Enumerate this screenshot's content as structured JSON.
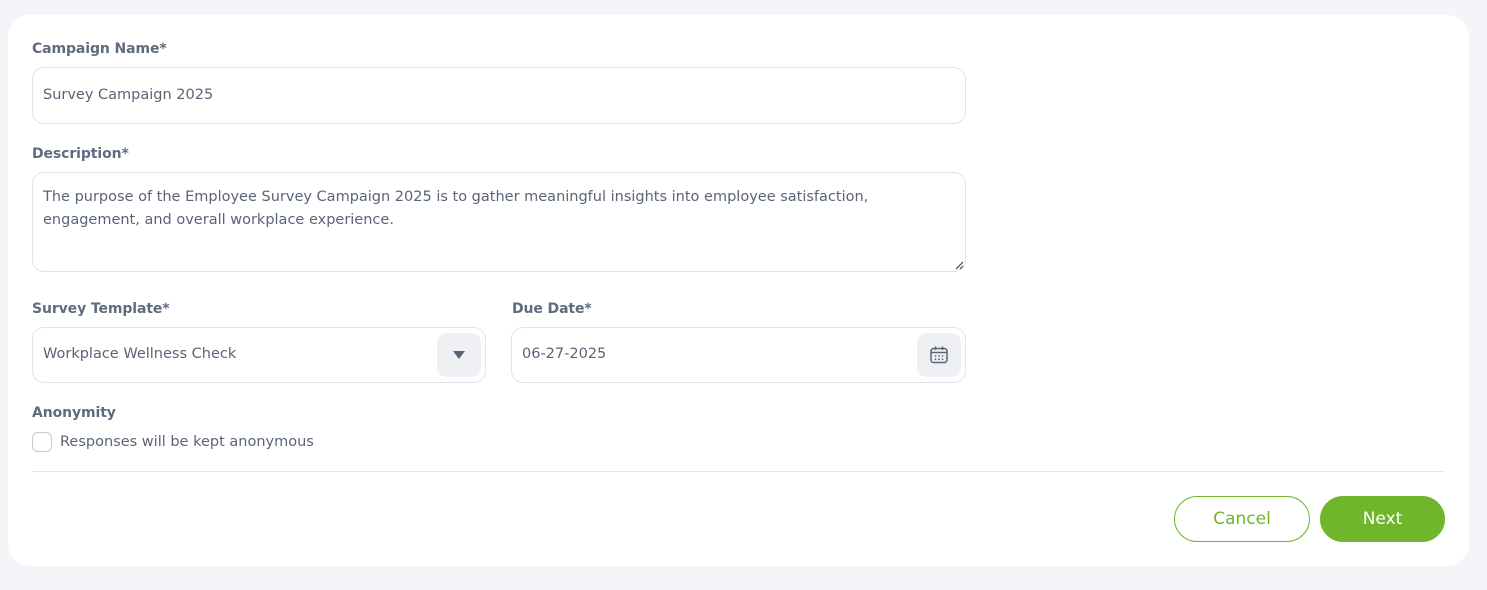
{
  "form": {
    "campaign_name": {
      "label": "Campaign Name*",
      "value": "Survey Campaign 2025"
    },
    "description": {
      "label": "Description*",
      "value": "The purpose of the Employee Survey Campaign 2025 is to gather meaningful insights into employee satisfaction, engagement, and overall workplace experience."
    },
    "survey_template": {
      "label": "Survey Template*",
      "value": "Workplace Wellness Check",
      "icon": "caret-down-icon"
    },
    "due_date": {
      "label": "Due Date*",
      "value": "06-27-2025",
      "icon": "calendar-icon"
    },
    "anonymity": {
      "label": "Anonymity",
      "checkbox_label": "Responses will be kept anonymous",
      "checked": false
    }
  },
  "actions": {
    "cancel_label": "Cancel",
    "next_label": "Next"
  },
  "colors": {
    "accent": "#6fb62c",
    "background": "#f5f5f9",
    "label": "#5f6b7e"
  }
}
